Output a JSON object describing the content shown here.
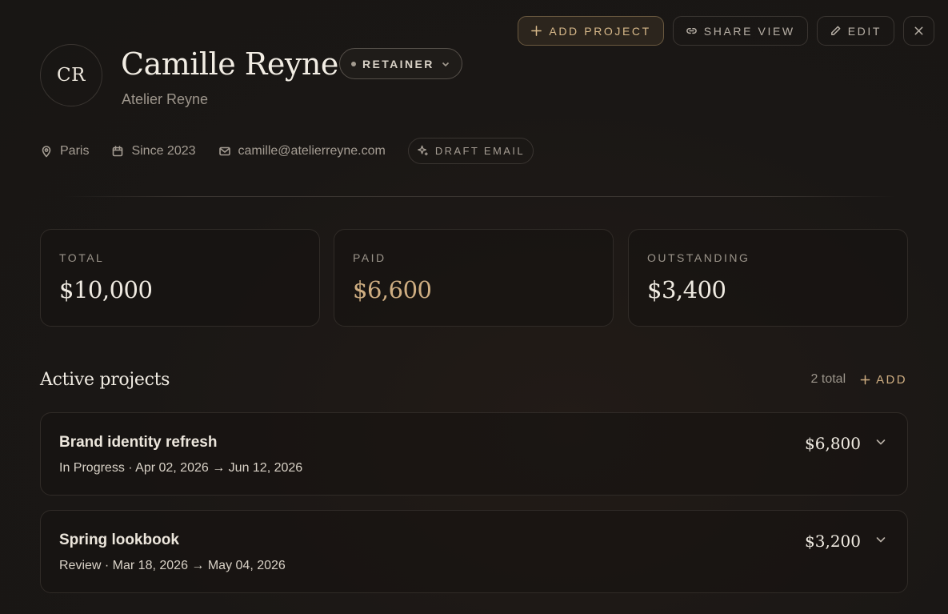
{
  "header": {
    "initials": "CR",
    "name": "Camille Reyne",
    "company": "Atelier Reyne",
    "badge_label": "RETAINER"
  },
  "actions": {
    "add_project": "ADD PROJECT",
    "share_view": "SHARE VIEW",
    "edit": "EDIT"
  },
  "meta": {
    "location": "Paris",
    "since": "Since 2023",
    "email": "camille@atelierreyne.com",
    "draft_email": "DRAFT EMAIL"
  },
  "stats": [
    {
      "label": "TOTAL",
      "value": "$10,000"
    },
    {
      "label": "PAID",
      "value": "$6,600"
    },
    {
      "label": "OUTSTANDING",
      "value": "$3,400"
    }
  ],
  "projects_section": {
    "title": "Active projects",
    "count": "2 total",
    "add_label": "ADD"
  },
  "projects": [
    {
      "name": "Brand identity refresh",
      "subtitle": "In Progress · Apr 02, 2026 → Jun 12, 2026",
      "amount": "$6,800"
    },
    {
      "name": "Spring lookbook",
      "subtitle": "Review · Mar 18, 2026 → May 04, 2026",
      "amount": "$3,200"
    }
  ],
  "colors": {
    "background": "#1a1715",
    "accent": "#cfae82",
    "text": "#ece6dc",
    "muted": "#9d958b",
    "border": "#3a3531"
  }
}
